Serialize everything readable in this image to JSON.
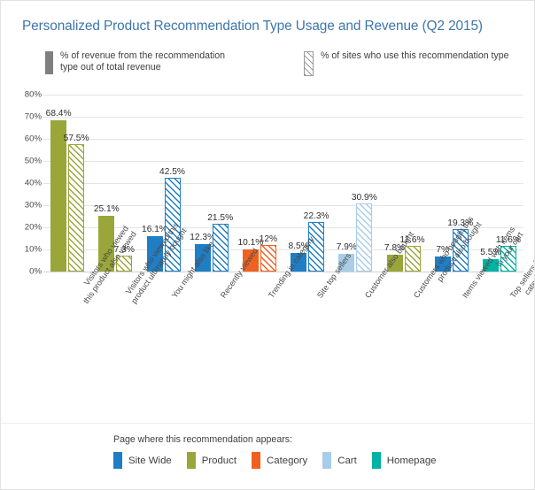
{
  "title": "Personalized Product Recommendation Type Usage and Revenue (Q2 2015)",
  "title_color": "#3d76ab",
  "top_legend": [
    {
      "swatch": "solid-gray-swatch-icon",
      "label": "% of revenue from the recommendation\ntype out of total revenue"
    },
    {
      "swatch": "hatched-gray-swatch-icon",
      "label": "% of sites who use this recommendation type"
    }
  ],
  "bottom_legend": {
    "title": "Page where this recommendation appears:",
    "items": [
      {
        "label": "Site Wide",
        "color": "#1f7ec4"
      },
      {
        "label": "Product",
        "color": "#9aa63a"
      },
      {
        "label": "Category",
        "color": "#f0611f"
      },
      {
        "label": "Cart",
        "color": "#a9cde8"
      },
      {
        "label": "Homepage",
        "color": "#00b3a4"
      }
    ]
  },
  "chart_data": {
    "type": "bar",
    "title": "Personalized Product Recommendation Type Usage and Revenue (Q2 2015)",
    "xlabel": "",
    "ylabel": "",
    "ylim": [
      0,
      80
    ],
    "ytick_labels": [
      "0%",
      "10%",
      "20%",
      "30%",
      "40%",
      "50%",
      "60%",
      "70%",
      "80%"
    ],
    "ytick_values": [
      0,
      10,
      20,
      30,
      40,
      50,
      60,
      70,
      80
    ],
    "grid": true,
    "legend_position": "bottom",
    "categories": [
      "Visitors who viewed\nthis product also viewed",
      "Visitors who viewed this\nproduct ultimately bought",
      "You might also like",
      "Recently viewed",
      "Trending in category",
      "Site top sellers",
      "Customer also bought",
      "Customers who bought this\nproduct also bought",
      "Items viewed with items\nin your cart",
      "Top sellers from your recent\ncategories on homepage"
    ],
    "series": [
      {
        "name": "% of revenue from the recommendation type out of total revenue",
        "style": "solid",
        "values": [
          68.4,
          25.1,
          16.1,
          12.3,
          10.1,
          8.5,
          7.9,
          7.8,
          7,
          5.5
        ],
        "labels": [
          "68.4%",
          "25.1%",
          "16.1%",
          "12.3%",
          "10.1%",
          "8.5%",
          "7.9%",
          "7.8%",
          "7%",
          "5.5%"
        ]
      },
      {
        "name": "% of sites who use this recommendation type",
        "style": "hatched",
        "values": [
          57.5,
          7.3,
          42.5,
          21.5,
          12,
          22.3,
          30.9,
          11.6,
          19.3,
          11.6
        ],
        "labels": [
          "57.5%",
          "7.3%",
          "42.5%",
          "21.5%",
          "12%",
          "22.3%",
          "30.9%",
          "11.6%",
          "19.3%",
          "11.6%"
        ]
      }
    ],
    "category_page_colors": [
      "#9aa63a",
      "#9aa63a",
      "#1f7ec4",
      "#1f7ec4",
      "#f0611f",
      "#1f7ec4",
      "#a9cde8",
      "#9aa63a",
      "#1f7ec4",
      "#00b3a4"
    ],
    "category_page_names": [
      "Product",
      "Product",
      "Site Wide",
      "Site Wide",
      "Category",
      "Site Wide",
      "Cart",
      "Product",
      "Site Wide",
      "Homepage"
    ]
  }
}
